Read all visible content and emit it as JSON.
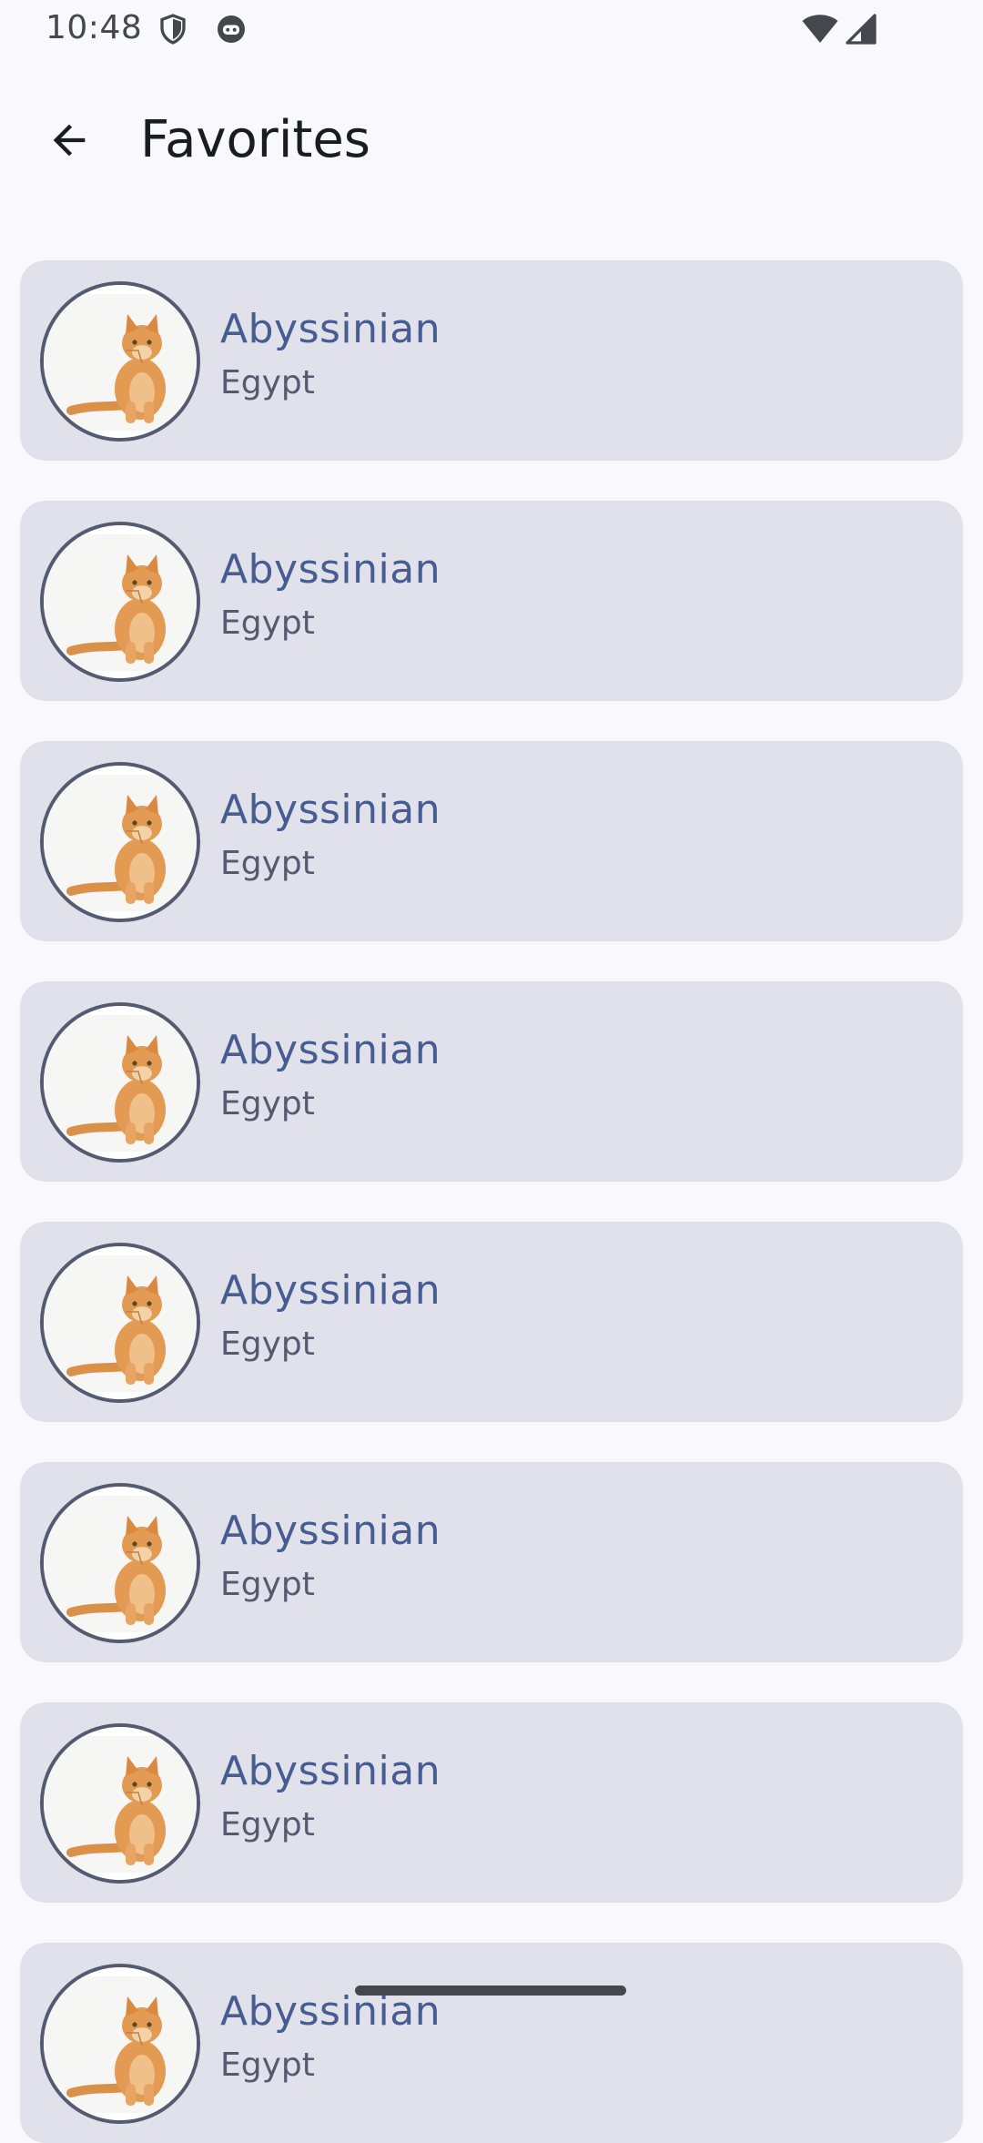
{
  "status_bar": {
    "time": "10:48",
    "icons": [
      "shield-icon",
      "android-face-icon",
      "wifi-icon",
      "signal-icon"
    ]
  },
  "app_bar": {
    "back_icon": "arrow-back-icon",
    "title": "Favorites"
  },
  "favorites": [
    {
      "name": "Abyssinian",
      "origin": "Egypt"
    },
    {
      "name": "Abyssinian",
      "origin": "Egypt"
    },
    {
      "name": "Abyssinian",
      "origin": "Egypt"
    },
    {
      "name": "Abyssinian",
      "origin": "Egypt"
    },
    {
      "name": "Abyssinian",
      "origin": "Egypt"
    },
    {
      "name": "Abyssinian",
      "origin": "Egypt"
    },
    {
      "name": "Abyssinian",
      "origin": "Egypt"
    },
    {
      "name": "Abyssinian",
      "origin": "Egypt"
    }
  ],
  "colors": {
    "background": "#f8f8fd",
    "card": "#e1e1eb",
    "name_text": "#475d92",
    "origin_text": "#545a6f",
    "avatar_border": "#545a6f"
  }
}
